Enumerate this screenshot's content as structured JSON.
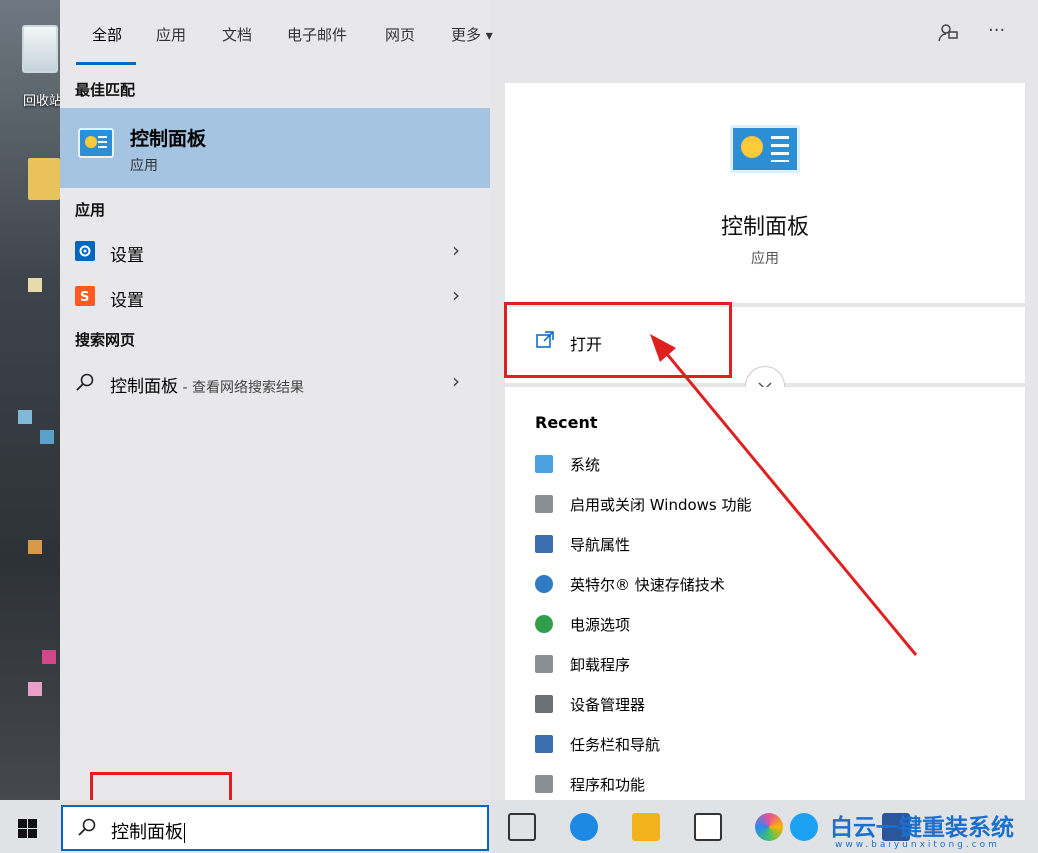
{
  "desktop": {
    "recycle_label": "回收站"
  },
  "tabs": [
    {
      "label": "全部"
    },
    {
      "label": "应用"
    },
    {
      "label": "文档"
    },
    {
      "label": "电子邮件"
    },
    {
      "label": "网页"
    },
    {
      "label": "更多"
    }
  ],
  "more_arrow": "▾",
  "top_icons": {
    "feedback": "feedback-icon",
    "more": "···"
  },
  "best_match": {
    "header": "最佳匹配",
    "title": "控制面板",
    "subtitle": "应用"
  },
  "apps": {
    "header": "应用",
    "items": [
      {
        "label": "设置",
        "icon": "gear-icon",
        "color": "#0067c0"
      },
      {
        "label": "设置",
        "icon": "sogou-icon",
        "color": "#ff5a1f"
      }
    ]
  },
  "web": {
    "header": "搜索网页",
    "query": "控制面板",
    "suffix": " - 查看网络搜索结果"
  },
  "detail": {
    "title": "控制面板",
    "subtitle": "应用",
    "open_label": "打开",
    "recent_header": "Recent",
    "recent": [
      {
        "label": "系统",
        "icon": "system-icon",
        "color": "#4aa3e0"
      },
      {
        "label": "启用或关闭 Windows 功能",
        "icon": "windows-features-icon",
        "color": "#8a8f94"
      },
      {
        "label": "导航属性",
        "icon": "navigation-icon",
        "color": "#3d6fb0"
      },
      {
        "label": "英特尔® 快速存储技术",
        "icon": "intel-rst-icon",
        "color": "#2e7bc4"
      },
      {
        "label": "电源选项",
        "icon": "power-icon",
        "color": "#2f9e4a"
      },
      {
        "label": "卸载程序",
        "icon": "uninstall-icon",
        "color": "#8a8f94"
      },
      {
        "label": "设备管理器",
        "icon": "device-manager-icon",
        "color": "#6b7075"
      },
      {
        "label": "任务栏和导航",
        "icon": "taskbar-icon",
        "color": "#3d6fb0"
      },
      {
        "label": "程序和功能",
        "icon": "programs-icon",
        "color": "#8a8f94"
      }
    ]
  },
  "taskbar": {
    "search_value": "控制面板",
    "icons": [
      {
        "name": "task-view-icon",
        "color": "#333333"
      },
      {
        "name": "edge-icon",
        "color": "#1e88e5"
      },
      {
        "name": "file-explorer-icon",
        "color": "#f2b21c"
      },
      {
        "name": "mail-icon",
        "color": "#333333"
      },
      {
        "name": "photos-icon",
        "color": "#e84f9b"
      },
      {
        "name": "twitter-icon",
        "color": "#1da1f2"
      },
      {
        "name": "word-icon",
        "color": "#2b579a"
      }
    ]
  },
  "watermark": {
    "text": "白云一键重装系统",
    "url": "www.baiyunxitong.com"
  },
  "colors": {
    "accent": "#0067c0",
    "annotation": "#e02020",
    "best_match_bg": "#a5c4e1"
  }
}
